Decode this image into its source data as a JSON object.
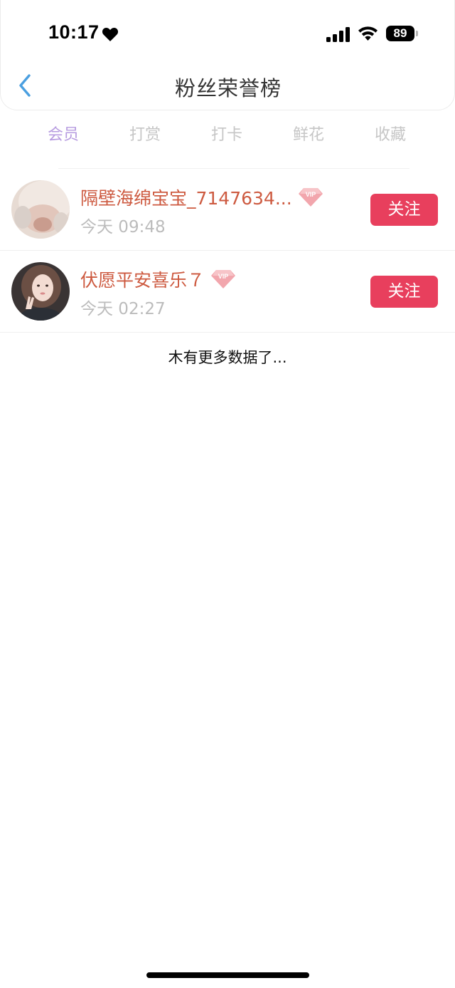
{
  "status_bar": {
    "time": "10:17",
    "battery": "89"
  },
  "header": {
    "title": "粉丝荣誉榜"
  },
  "tabs": [
    {
      "label": "会员",
      "active": true
    },
    {
      "label": "打赏",
      "active": false
    },
    {
      "label": "打卡",
      "active": false
    },
    {
      "label": "鲜花",
      "active": false
    },
    {
      "label": "收藏",
      "active": false
    }
  ],
  "fans": [
    {
      "name": "隔壁海绵宝宝_7147634...",
      "time": "今天 09:48",
      "badge": "VIP",
      "follow_label": "关注"
    },
    {
      "name": "伏愿平安喜乐７",
      "time": "今天 02:27",
      "badge": "VIP",
      "follow_label": "关注"
    }
  ],
  "footer_text": "木有更多数据了...",
  "colors": {
    "accent_tab": "#b79ce0",
    "name": "#cd5a40",
    "follow_button": "#e83f5d",
    "back_arrow": "#4a9fe0"
  },
  "icons": [
    "heart-icon",
    "signal-icon",
    "wifi-icon",
    "battery-icon",
    "back-arrow-icon",
    "vip-diamond-icon"
  ]
}
